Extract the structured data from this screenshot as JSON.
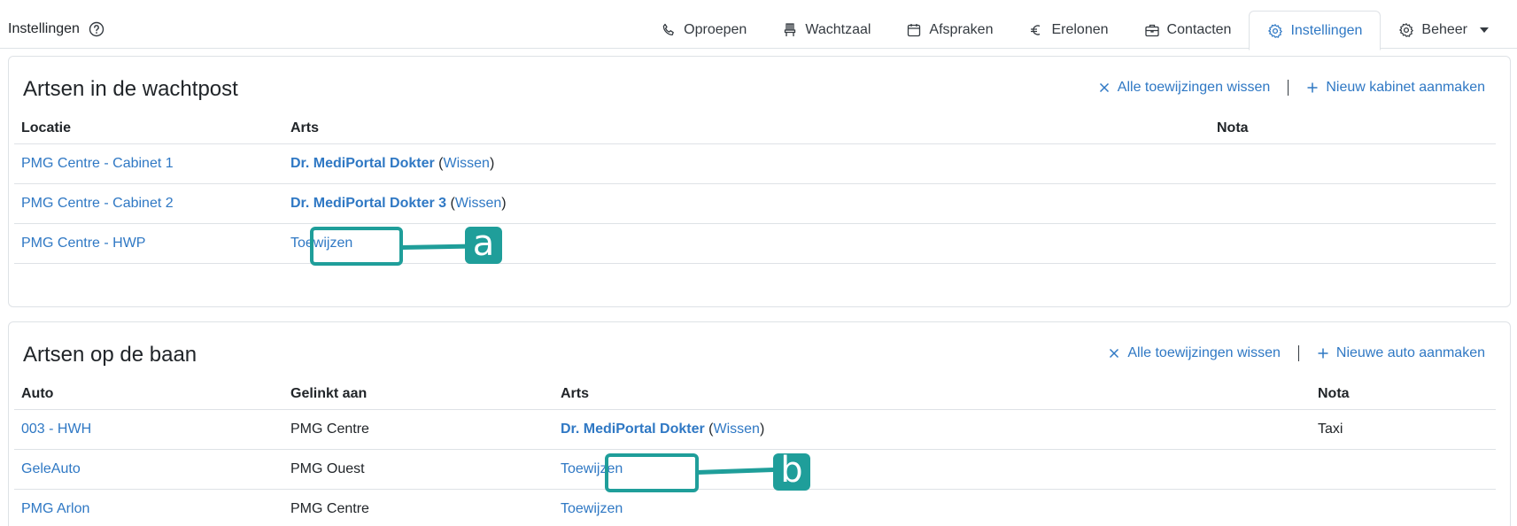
{
  "header": {
    "title": "Instellingen",
    "tabs": [
      {
        "label": "Oproepen",
        "icon": "phone-icon"
      },
      {
        "label": "Wachtzaal",
        "icon": "chair-icon"
      },
      {
        "label": "Afspraken",
        "icon": "calendar-icon"
      },
      {
        "label": "Erelonen",
        "icon": "euro-icon"
      },
      {
        "label": "Contacten",
        "icon": "briefcase-icon"
      },
      {
        "label": "Instellingen",
        "icon": "gear-icon",
        "active": true
      },
      {
        "label": "Beheer",
        "icon": "gear-icon"
      }
    ]
  },
  "wachtpost": {
    "title": "Artsen in de wachtpost",
    "clear_all": "Alle toewijzingen wissen",
    "new_label": "Nieuw kabinet aanmaken",
    "columns": {
      "location": "Locatie",
      "doctor": "Arts",
      "note": "Nota"
    },
    "rows": [
      {
        "location": "PMG Centre - Cabinet 1",
        "doctor": "Dr. MediPortal Dokter",
        "clear": "Wissen",
        "note": ""
      },
      {
        "location": "PMG Centre - Cabinet 2",
        "doctor": "Dr. MediPortal Dokter 3",
        "clear": "Wissen",
        "note": ""
      },
      {
        "location": "PMG Centre - HWP",
        "assign": "Toewijzen",
        "note": ""
      }
    ]
  },
  "baan": {
    "title": "Artsen op de baan",
    "clear_all": "Alle toewijzingen wissen",
    "new_label": "Nieuwe auto aanmaken",
    "columns": {
      "car": "Auto",
      "linked": "Gelinkt aan",
      "doctor": "Arts",
      "note": "Nota"
    },
    "rows": [
      {
        "car": "003 - HWH",
        "linked": "PMG Centre",
        "doctor": "Dr. MediPortal Dokter",
        "clear": "Wissen",
        "note": "Taxi"
      },
      {
        "car": "GeleAuto",
        "linked": "PMG Ouest",
        "assign": "Toewijzen",
        "note": ""
      },
      {
        "car": "PMG Arlon",
        "linked": "PMG Centre",
        "assign": "Toewijzen",
        "note": ""
      }
    ]
  },
  "annotations": {
    "a": "a",
    "b": "b",
    "color": "#1f9e9a"
  },
  "colors": {
    "link": "#2f78c4",
    "accent": "#1f9e9a"
  }
}
